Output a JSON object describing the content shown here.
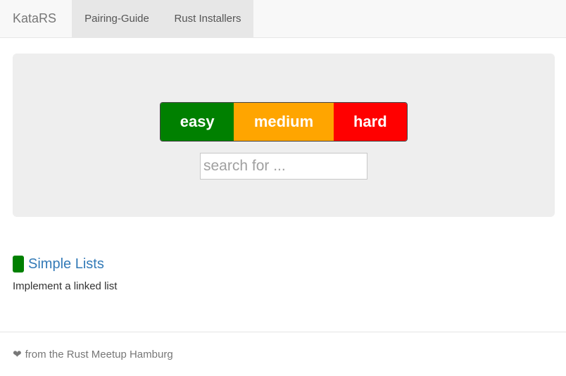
{
  "navbar": {
    "brand": "KataRS",
    "links": [
      {
        "label": "Pairing-Guide"
      },
      {
        "label": "Rust Installers"
      }
    ]
  },
  "filters": {
    "easy": {
      "label": "easy",
      "color": "#008000"
    },
    "medium": {
      "label": "medium",
      "color": "#FFA500"
    },
    "hard": {
      "label": "hard",
      "color": "#FF0000"
    }
  },
  "search": {
    "placeholder": "search for ...",
    "value": ""
  },
  "katas": [
    {
      "title": "Simple Lists",
      "description": "Implement a linked list",
      "level_color": "#008000"
    }
  ],
  "footer": {
    "icon": "heart-icon",
    "text": "from the Rust Meetup Hamburg"
  }
}
